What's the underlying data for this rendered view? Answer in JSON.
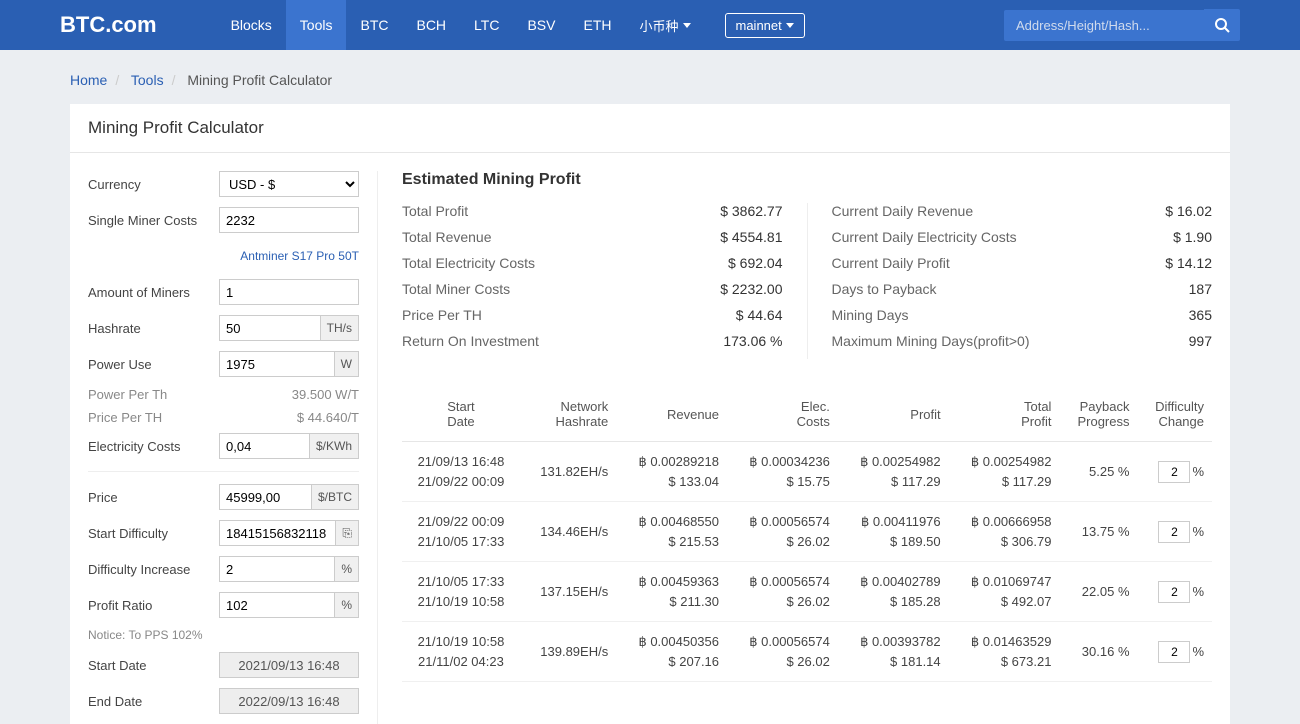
{
  "header": {
    "logo": "BTC.com",
    "nav": [
      "Blocks",
      "Tools",
      "BTC",
      "BCH",
      "LTC",
      "BSV",
      "ETH"
    ],
    "misc": "小币种",
    "net": "mainnet",
    "search_placeholder": "Address/Height/Hash..."
  },
  "breadcrumb": {
    "home": "Home",
    "tools": "Tools",
    "current": "Mining Profit Calculator"
  },
  "title": "Mining Profit Calculator",
  "form": {
    "currency_label": "Currency",
    "currency_value": "USD - $",
    "miner_costs_label": "Single Miner Costs",
    "miner_costs_value": "2232",
    "miner_link": "Antminer S17 Pro 50T",
    "amount_label": "Amount of Miners",
    "amount_value": "1",
    "hashrate_label": "Hashrate",
    "hashrate_value": "50",
    "hashrate_unit": "TH/s",
    "power_label": "Power Use",
    "power_value": "1975",
    "power_unit": "W",
    "power_per_th_label": "Power Per Th",
    "power_per_th_value": "39.500 W/T",
    "price_per_th_label": "Price Per TH",
    "price_per_th_value": "$ 44.640/T",
    "elec_label": "Electricity Costs",
    "elec_value": "0,04",
    "elec_unit": "$/KWh",
    "price_label": "Price",
    "price_value": "45999,00",
    "price_unit": "$/BTC",
    "diff_label": "Start Difficulty",
    "diff_value": "18415156832118",
    "diff_inc_label": "Difficulty Increase",
    "diff_inc_value": "2",
    "pct": "%",
    "profit_ratio_label": "Profit Ratio",
    "profit_ratio_value": "102",
    "notice": "Notice: To PPS 102%",
    "start_date_label": "Start Date",
    "start_date_value": "2021/09/13 16:48",
    "end_date_label": "End Date",
    "end_date_value": "2022/09/13 16:48"
  },
  "summary": {
    "title": "Estimated Mining Profit",
    "left": [
      {
        "label": "Total Profit",
        "value": "$ 3862.77"
      },
      {
        "label": "Total Revenue",
        "value": "$ 4554.81"
      },
      {
        "label": "Total Electricity Costs",
        "value": "$ 692.04"
      },
      {
        "label": "Total Miner Costs",
        "value": "$ 2232.00"
      },
      {
        "label": "Price Per TH",
        "value": "$ 44.64"
      },
      {
        "label": "Return On Investment",
        "value": "173.06 %"
      }
    ],
    "right": [
      {
        "label": "Current Daily Revenue",
        "value": "$ 16.02"
      },
      {
        "label": "Current Daily Electricity Costs",
        "value": "$ 1.90"
      },
      {
        "label": "Current Daily Profit",
        "value": "$ 14.12"
      },
      {
        "label": "Days to Payback",
        "value": "187"
      },
      {
        "label": "Mining Days",
        "value": "365"
      },
      {
        "label": "Maximum Mining Days(profit>0)",
        "value": "997"
      }
    ]
  },
  "table": {
    "headers": [
      "Start Date",
      "Network Hashrate",
      "Revenue",
      "Elec. Costs",
      "Profit",
      "Total Profit",
      "Payback Progress",
      "Difficulty Change"
    ],
    "rows": [
      {
        "d1": "21/09/13 16:48",
        "d2": "21/09/22 00:09",
        "hr": "131.82EH/s",
        "rb": "฿ 0.00289218",
        "ru": "$ 133.04",
        "eb": "฿ 0.00034236",
        "eu": "$ 15.75",
        "pb": "฿ 0.00254982",
        "pu": "$ 117.29",
        "tb": "฿ 0.00254982",
        "tu": "$ 117.29",
        "pp": "5.25 %",
        "dc": "2"
      },
      {
        "d1": "21/09/22 00:09",
        "d2": "21/10/05 17:33",
        "hr": "134.46EH/s",
        "rb": "฿ 0.00468550",
        "ru": "$ 215.53",
        "eb": "฿ 0.00056574",
        "eu": "$ 26.02",
        "pb": "฿ 0.00411976",
        "pu": "$ 189.50",
        "tb": "฿ 0.00666958",
        "tu": "$ 306.79",
        "pp": "13.75 %",
        "dc": "2"
      },
      {
        "d1": "21/10/05 17:33",
        "d2": "21/10/19 10:58",
        "hr": "137.15EH/s",
        "rb": "฿ 0.00459363",
        "ru": "$ 211.30",
        "eb": "฿ 0.00056574",
        "eu": "$ 26.02",
        "pb": "฿ 0.00402789",
        "pu": "$ 185.28",
        "tb": "฿ 0.01069747",
        "tu": "$ 492.07",
        "pp": "22.05 %",
        "dc": "2"
      },
      {
        "d1": "21/10/19 10:58",
        "d2": "21/11/02 04:23",
        "hr": "139.89EH/s",
        "rb": "฿ 0.00450356",
        "ru": "$ 207.16",
        "eb": "฿ 0.00056574",
        "eu": "$ 26.02",
        "pb": "฿ 0.00393782",
        "pu": "$ 181.14",
        "tb": "฿ 0.01463529",
        "tu": "$ 673.21",
        "pp": "30.16 %",
        "dc": "2"
      }
    ]
  }
}
